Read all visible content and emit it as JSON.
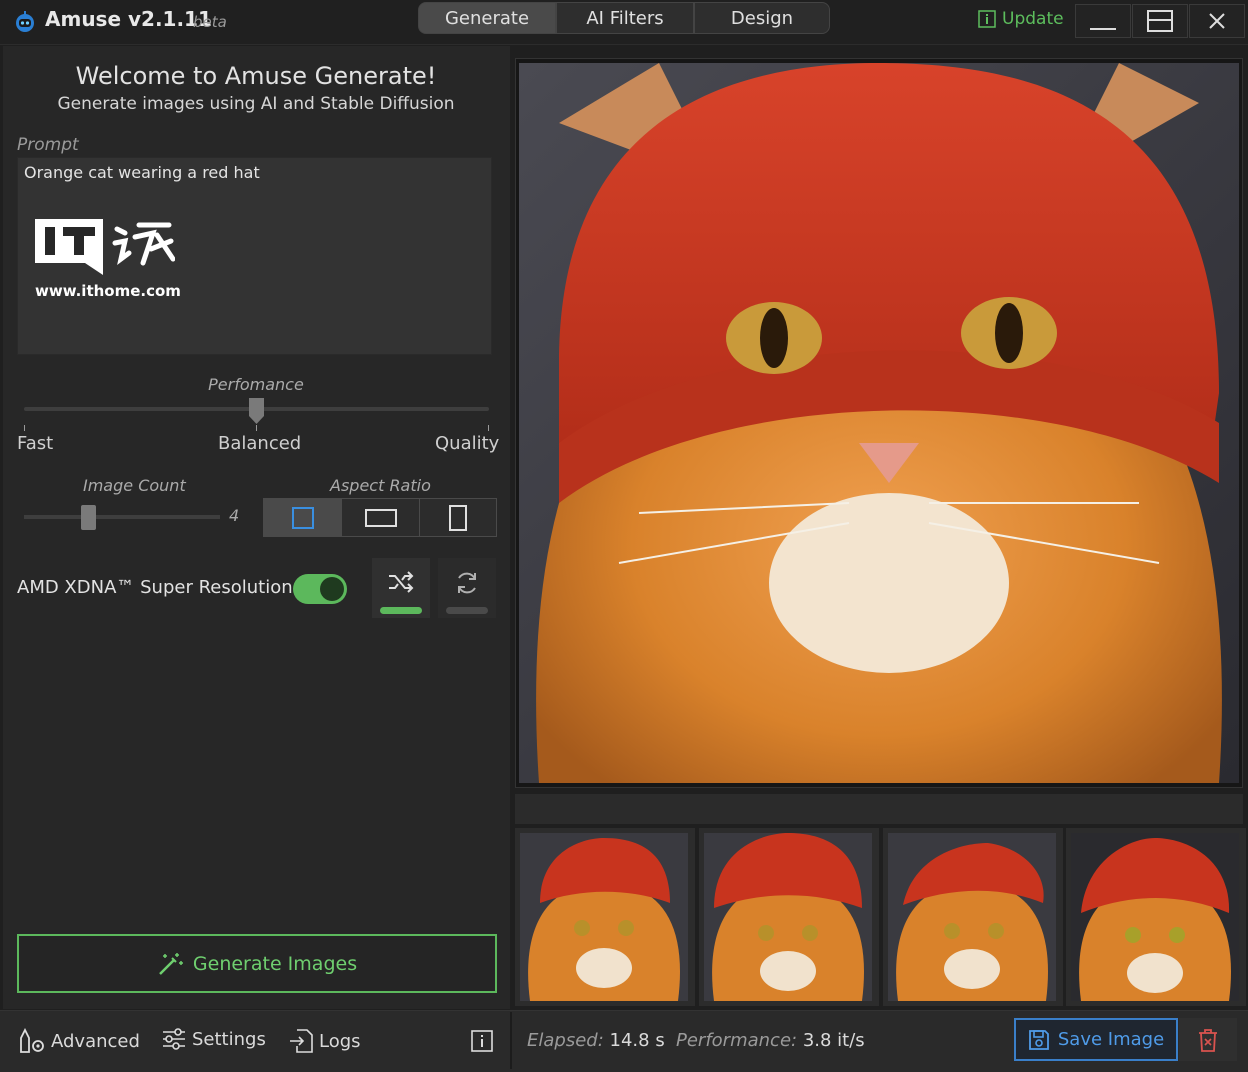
{
  "app": {
    "title": "Amuse v2.1.11",
    "beta": "beta"
  },
  "tabs": [
    {
      "label": "Generate"
    },
    {
      "label": "AI Filters"
    },
    {
      "label": "Design"
    }
  ],
  "update_label": "Update",
  "welcome": {
    "title": "Welcome to Amuse Generate!",
    "subtitle": "Generate images using AI and Stable Diffusion"
  },
  "prompt": {
    "label": "Prompt",
    "value": "Orange cat wearing a red hat"
  },
  "watermark": {
    "url": "www.ithome.com"
  },
  "performance": {
    "label": "Perfomance",
    "ticks": [
      "Fast",
      "Balanced",
      "Quality"
    ],
    "value": "Balanced"
  },
  "image_count": {
    "label": "Image Count",
    "value": "4"
  },
  "aspect_ratio": {
    "label": "Aspect Ratio",
    "selected": "square"
  },
  "xdna": {
    "label": "AMD XDNA™ Super Resolution",
    "enabled": true
  },
  "generate_button": "Generate Images",
  "bottom": {
    "advanced": "Advanced",
    "settings": "Settings",
    "logs": "Logs",
    "elapsed_label": "Elapsed:",
    "elapsed_value": "14.8 s",
    "performance_label": "Performance:",
    "performance_value": "3.8 it/s",
    "save": "Save Image"
  },
  "colors": {
    "accent_green": "#5cb85c",
    "accent_blue": "#3a7fc9",
    "danger": "#d9534f",
    "hat": "#c8341e",
    "fur": "#d9822b"
  }
}
